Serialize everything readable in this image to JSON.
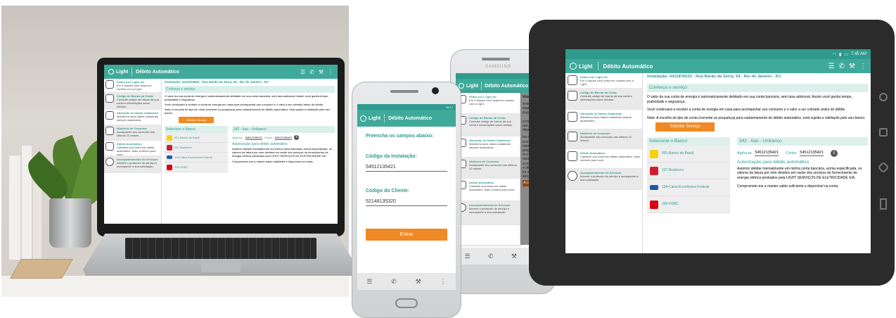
{
  "app": {
    "logo": "Light",
    "title": "Débito Automático",
    "time": "7:45 AM",
    "phone_time": "08:17",
    "brand": "SAMSUNG"
  },
  "drawer": {
    "items": [
      {
        "title": "Faltou luz? Light Já!",
        "desc": "Em 3 cliques você avisa em contato com a Light."
      },
      {
        "title": "Código de Barras da Conta",
        "desc": "Consulte código de barras da sua conta e informações sobre débitos."
      },
      {
        "title": "Alteração de Dados Cadastrais",
        "desc": "Mantenha seus dados cadastrais sempre atualizados."
      },
      {
        "title": "Histórico de Consumo",
        "desc": "Acompanhe seu consumo dos últimos 12 meses."
      },
      {
        "title": "Débito Automático",
        "desc": "Cadastre sua conta em débito automático. Mais conforto para você."
      },
      {
        "title": "Acompanhamento de Serviços",
        "desc": "Informe o protocolo do serviço e acompanhe a sua solicitação."
      }
    ]
  },
  "main": {
    "installation": "Instalação: 0411876532 - Rua Barão da Serra, 54 - Rio de Janeiro - RJ",
    "section": "Conheça o serviço",
    "p1": "O valor da sua conta de energia é automaticamente debitado em sua conta bancária, sem taxa adicional. Assim você ganha tempo, praticidade e segurança.",
    "p2": "Você continuará a receber a conta de energia em casa para acompanhar seu consumo e o valor a ser cobrado antes do débito.",
    "note": "Nota: A escolha do tipo de conta (corrente ou poupança) para cadastramento do débito automático, está sujeita a validação pelo seu banco.",
    "request_button": "Solicitar Serviço",
    "bank_header": "Selecione o Banco",
    "banks": [
      "001-Banco do Brasil",
      "237-Bradesco",
      "104-Caixa Econômica Federal",
      "399-HSBC"
    ],
    "bank_icons": [
      "bb-icon",
      "bradesco-icon",
      "caixa-icon",
      "hsbc-icon"
    ],
    "bank_colors": [
      "#f5d20f",
      "#cc1f2d",
      "#1c5aa8",
      "#db0011"
    ],
    "selected_bank": "342 - Itaú - Unibanco",
    "agency_label": "Agência:",
    "agency_value": "54512135421",
    "account_label": "Conta:",
    "account_value": "54512135421",
    "auth_title": "Autorização para débito automático",
    "auth_text": "Autorizo debitar mensalmente em minha conta bancária, acima especificada, os valores da fatura por mim devidos em razão dos serviços de fornecimento de energia elétrica prestados pela LIGHT SERVIÇOS DE ELETRICIDADE S/A.",
    "commit_text": "Comprometo-me a manter saldo suficiente e disponível na conta."
  },
  "phone_form": {
    "heading": "Preencha os campos abaixo:",
    "install_label": "Código da Instalação:",
    "install_value": "54512135421",
    "client_label": "Código do Cliente:",
    "client_value": "52148135320",
    "submit": "Entrar"
  },
  "phone2_overflow": {
    "lines": [
      "kbid",
      "ente será",
      "espondência",
      "Política de",
      "a instalação",
      "ara Android",
      "disponibil-",
      "tes ofereci-",
      "a enviar no-",
      "ciente, tais",
      "programada",
      "m o resta-",
      "ancelamen-",
      "e ocia de pos-",
      "e débito au-",
      "es sobre o",
      "stor, além de",
      "Acordo"
    ]
  },
  "colors": {
    "teal": "#3fa99a",
    "dark_teal": "#2e9b8e",
    "orange": "#f08a24"
  }
}
